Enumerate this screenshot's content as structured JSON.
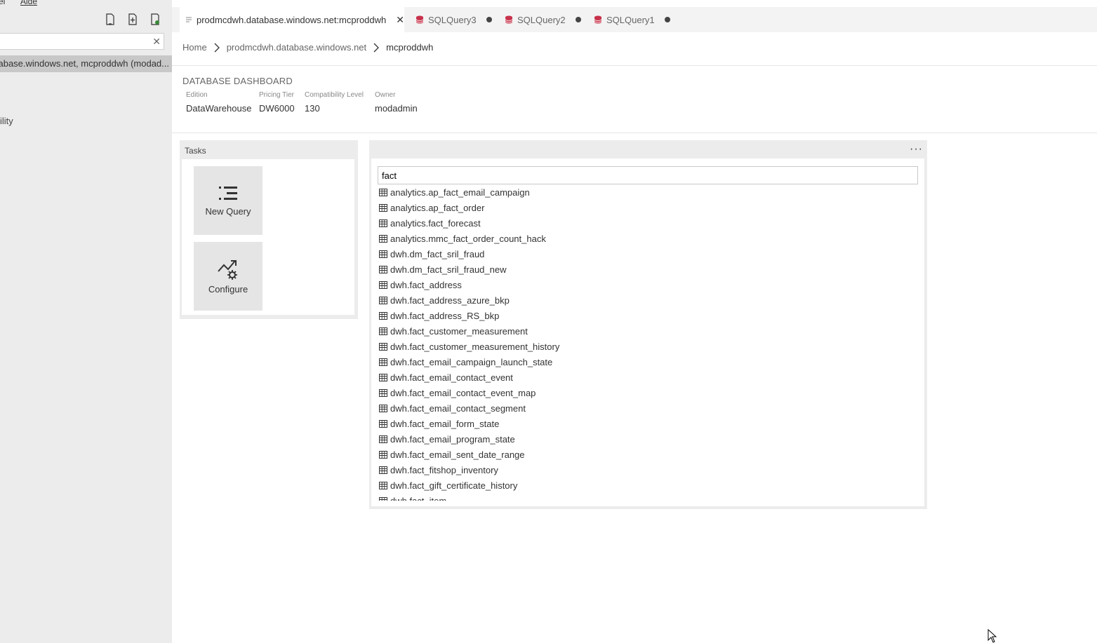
{
  "menubar": {
    "item_left": "el",
    "item_help": "Aide"
  },
  "sidebar": {
    "search_value": "",
    "clear_label": "✕",
    "selected_connection": "abase.windows.net, mcproddwh (modad...",
    "partial_item": "ility"
  },
  "tabs": [
    {
      "label": "prodmcdwh.database.windows.net:mcproddwh",
      "close": "✕"
    },
    {
      "label": "SQLQuery3"
    },
    {
      "label": "SQLQuery2"
    },
    {
      "label": "SQLQuery1"
    }
  ],
  "breadcrumb": {
    "home": "Home",
    "server": "prodmcdwh.database.windows.net",
    "database": "mcproddwh"
  },
  "dashboard": {
    "title": "DATABASE DASHBOARD",
    "properties": [
      {
        "label": "Edition",
        "value": "DataWarehouse"
      },
      {
        "label": "Pricing Tier",
        "value": "DW6000"
      },
      {
        "label": "Compatibility Level",
        "value": "130"
      },
      {
        "label": "Owner",
        "value": "modadmin"
      }
    ]
  },
  "tasks": {
    "header": "Tasks",
    "new_query": "New Query",
    "configure": "Configure"
  },
  "explorer": {
    "more": "···",
    "filter_value": "fact",
    "tables": [
      "analytics.ap_fact_email_campaign",
      "analytics.ap_fact_order",
      "analytics.fact_forecast",
      "analytics.mmc_fact_order_count_hack",
      "dwh.dm_fact_sril_fraud",
      "dwh.dm_fact_sril_fraud_new",
      "dwh.fact_address",
      "dwh.fact_address_azure_bkp",
      "dwh.fact_address_RS_bkp",
      "dwh.fact_customer_measurement",
      "dwh.fact_customer_measurement_history",
      "dwh.fact_email_campaign_launch_state",
      "dwh.fact_email_contact_event",
      "dwh.fact_email_contact_event_map",
      "dwh.fact_email_contact_segment",
      "dwh.fact_email_form_state",
      "dwh.fact_email_program_state",
      "dwh.fact_email_sent_date_range",
      "dwh.fact_fitshop_inventory",
      "dwh.fact_gift_certificate_history",
      "dwh.fact_item"
    ]
  }
}
